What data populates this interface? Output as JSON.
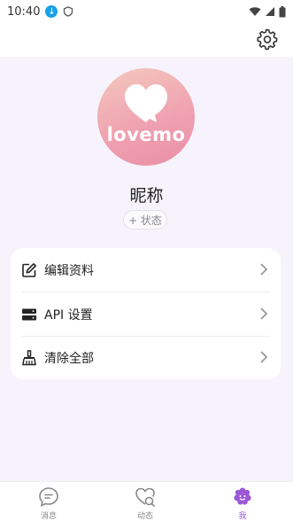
{
  "status_bar": {
    "time": "10:40"
  },
  "profile": {
    "logo_text": "lovemo",
    "nickname": "昵称",
    "status_chip": "+ 状态"
  },
  "menu": [
    {
      "label": "编辑资料",
      "icon": "edit-icon"
    },
    {
      "label": "API 设置",
      "icon": "server-icon"
    },
    {
      "label": "清除全部",
      "icon": "broom-icon"
    }
  ],
  "nav": [
    {
      "label": "消息",
      "icon": "chat-icon"
    },
    {
      "label": "动态",
      "icon": "moments-icon"
    },
    {
      "label": "我",
      "icon": "me-icon",
      "active": true
    }
  ],
  "colors": {
    "accent": "#9b59d6",
    "avatar_gradient": [
      "#f4c9bd",
      "#ea8fa6"
    ],
    "background": "#f6f3fc"
  }
}
